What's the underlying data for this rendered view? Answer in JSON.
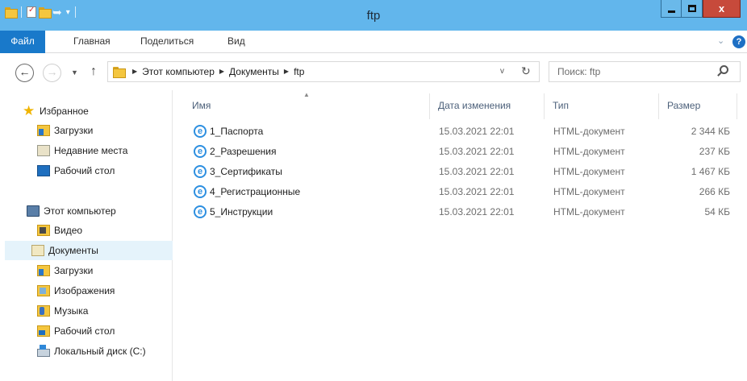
{
  "window": {
    "title": "ftp",
    "qat_dropdown": "▾",
    "minimize_label": "",
    "maximize_label": "",
    "close_label": "x"
  },
  "ribbon": {
    "tabs": [
      {
        "label": "Файл"
      },
      {
        "label": "Главная"
      },
      {
        "label": "Поделиться"
      },
      {
        "label": "Вид"
      }
    ],
    "expand_chevron": "⌄",
    "help": "?"
  },
  "navigation": {
    "back": "←",
    "forward": "→",
    "recent_dropdown": "▼",
    "up": "↑",
    "breadcrumbs": [
      "Этот компьютер",
      "Документы",
      "ftp"
    ],
    "address_dropdown": "v",
    "refresh": "↻"
  },
  "search": {
    "placeholder": "Поиск: ftp"
  },
  "nav_pane": {
    "favorites": {
      "label": "Избранное",
      "items": [
        {
          "label": "Загрузки",
          "icon": "downloads-icon"
        },
        {
          "label": "Недавние места",
          "icon": "recent-places-icon"
        },
        {
          "label": "Рабочий стол",
          "icon": "desktop-icon"
        }
      ]
    },
    "computer": {
      "label": "Этот компьютер",
      "items": [
        {
          "label": "Видео",
          "icon": "videos-icon"
        },
        {
          "label": "Документы",
          "icon": "documents-icon",
          "selected": true
        },
        {
          "label": "Загрузки",
          "icon": "downloads-icon"
        },
        {
          "label": "Изображения",
          "icon": "pictures-icon"
        },
        {
          "label": "Музыка",
          "icon": "music-icon"
        },
        {
          "label": "Рабочий стол",
          "icon": "desktop-icon"
        },
        {
          "label": "Локальный диск (C:)",
          "icon": "local-disk-icon"
        }
      ]
    }
  },
  "file_list": {
    "columns": {
      "name": "Имя",
      "date": "Дата изменения",
      "type": "Тип",
      "size": "Размер"
    },
    "sort_indicator": "▲",
    "rows": [
      {
        "name": "1_Паспорта",
        "date": "15.03.2021 22:01",
        "type": "HTML-документ",
        "size": "2 344 КБ"
      },
      {
        "name": "2_Разрешения",
        "date": "15.03.2021 22:01",
        "type": "HTML-документ",
        "size": "237 КБ"
      },
      {
        "name": "3_Сертификаты",
        "date": "15.03.2021 22:01",
        "type": "HTML-документ",
        "size": "1 467 КБ"
      },
      {
        "name": "4_Регистрационные",
        "date": "15.03.2021 22:01",
        "type": "HTML-документ",
        "size": "266 КБ"
      },
      {
        "name": "5_Инструкции",
        "date": "15.03.2021 22:01",
        "type": "HTML-документ",
        "size": "54 КБ"
      }
    ],
    "file_icon_glyph": "e"
  },
  "colors": {
    "titlebar": "#62b6ec",
    "file_tab": "#1979ca",
    "close_button": "#c74a3b",
    "selection": "#e5f3fb"
  }
}
